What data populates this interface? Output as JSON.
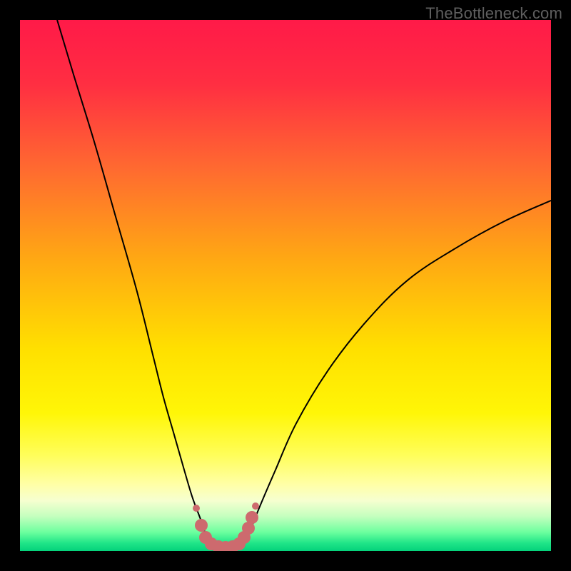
{
  "watermark": "TheBottleneck.com",
  "colors": {
    "marker": "#cd6a6e",
    "curve": "#000000",
    "frame_bg": "#000000"
  },
  "gradient_stops": [
    {
      "offset": 0.0,
      "color": "#ff1a48"
    },
    {
      "offset": 0.12,
      "color": "#ff2e42"
    },
    {
      "offset": 0.28,
      "color": "#ff6a30"
    },
    {
      "offset": 0.45,
      "color": "#ffa813"
    },
    {
      "offset": 0.62,
      "color": "#ffe000"
    },
    {
      "offset": 0.74,
      "color": "#fff607"
    },
    {
      "offset": 0.82,
      "color": "#fffe5b"
    },
    {
      "offset": 0.875,
      "color": "#ffffa7"
    },
    {
      "offset": 0.905,
      "color": "#f6ffd0"
    },
    {
      "offset": 0.935,
      "color": "#c4ffbe"
    },
    {
      "offset": 0.965,
      "color": "#6bff9e"
    },
    {
      "offset": 0.985,
      "color": "#20e588"
    },
    {
      "offset": 1.0,
      "color": "#04d27b"
    }
  ],
  "chart_data": {
    "type": "line",
    "title": "",
    "xlabel": "",
    "ylabel": "",
    "xlim": [
      0,
      100
    ],
    "ylim": [
      0,
      100
    ],
    "series": [
      {
        "name": "left-branch",
        "x": [
          7,
          10,
          14,
          18,
          22,
          25,
          27,
          29,
          31,
          32.5,
          34,
          35,
          35.8
        ],
        "y": [
          100,
          90,
          77,
          63,
          49,
          37,
          29,
          22,
          15,
          10,
          6,
          3,
          1
        ]
      },
      {
        "name": "right-branch",
        "x": [
          42,
          43,
          45,
          48,
          52,
          58,
          65,
          73,
          82,
          91,
          100
        ],
        "y": [
          1,
          3,
          8,
          15,
          24,
          34,
          43,
          51,
          57,
          62,
          66
        ]
      },
      {
        "name": "valley-flat",
        "x": [
          35.8,
          37,
          38.5,
          40,
          41,
          42
        ],
        "y": [
          1,
          0.5,
          0.4,
          0.4,
          0.5,
          1
        ]
      }
    ],
    "markers": {
      "name": "bottom-highlight",
      "color": "#cd6a6e",
      "points": [
        {
          "x": 33.2,
          "y": 8.0,
          "size": "small"
        },
        {
          "x": 34.2,
          "y": 4.8,
          "size": "big"
        },
        {
          "x": 35.0,
          "y": 2.6,
          "size": "big"
        },
        {
          "x": 36.0,
          "y": 1.3,
          "size": "big"
        },
        {
          "x": 37.3,
          "y": 0.8,
          "size": "big"
        },
        {
          "x": 38.7,
          "y": 0.7,
          "size": "big"
        },
        {
          "x": 40.0,
          "y": 0.8,
          "size": "big"
        },
        {
          "x": 41.2,
          "y": 1.3,
          "size": "big"
        },
        {
          "x": 42.2,
          "y": 2.5,
          "size": "big"
        },
        {
          "x": 43.0,
          "y": 4.3,
          "size": "big"
        },
        {
          "x": 43.7,
          "y": 6.3,
          "size": "big"
        },
        {
          "x": 44.3,
          "y": 8.5,
          "size": "small"
        }
      ]
    }
  }
}
